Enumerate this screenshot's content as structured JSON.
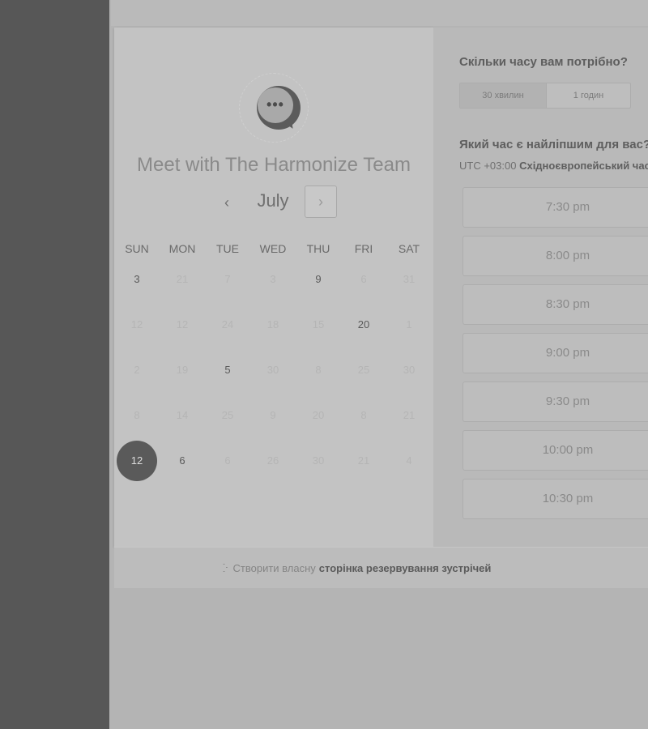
{
  "booking": {
    "title": "Meet with The Harmonize Team",
    "month": "July",
    "prev_glyph": "‹",
    "next_glyph": "›",
    "weekdays": [
      "SUN",
      "MON",
      "TUE",
      "WED",
      "THU",
      "FRI",
      "SAT"
    ],
    "weeks": [
      [
        {
          "d": "3",
          "a": true
        },
        {
          "d": "21",
          "a": false
        },
        {
          "d": "7",
          "a": false
        },
        {
          "d": "3",
          "a": false
        },
        {
          "d": "9",
          "a": true
        },
        {
          "d": "6",
          "a": false
        },
        {
          "d": "31",
          "a": false
        }
      ],
      [
        {
          "d": "12",
          "a": false
        },
        {
          "d": "12",
          "a": false
        },
        {
          "d": "24",
          "a": false
        },
        {
          "d": "18",
          "a": false
        },
        {
          "d": "15",
          "a": false
        },
        {
          "d": "20",
          "a": true
        },
        {
          "d": "1",
          "a": false
        }
      ],
      [
        {
          "d": "2",
          "a": false
        },
        {
          "d": "19",
          "a": false
        },
        {
          "d": "5",
          "a": true
        },
        {
          "d": "30",
          "a": false
        },
        {
          "d": "8",
          "a": false
        },
        {
          "d": "25",
          "a": false
        },
        {
          "d": "30",
          "a": false
        }
      ],
      [
        {
          "d": "8",
          "a": false
        },
        {
          "d": "14",
          "a": false
        },
        {
          "d": "25",
          "a": false
        },
        {
          "d": "9",
          "a": false
        },
        {
          "d": "20",
          "a": false
        },
        {
          "d": "8",
          "a": false
        },
        {
          "d": "21",
          "a": false
        }
      ],
      [
        {
          "d": "12",
          "a": true,
          "selected": true
        },
        {
          "d": "6",
          "a": true
        },
        {
          "d": "6",
          "a": false
        },
        {
          "d": "26",
          "a": false
        },
        {
          "d": "30",
          "a": false
        },
        {
          "d": "21",
          "a": false
        },
        {
          "d": "4",
          "a": false
        }
      ]
    ]
  },
  "scheduler": {
    "duration_question": "Скільки часу вам потрібно?",
    "durations": [
      {
        "label": "30 хвилин",
        "active": true
      },
      {
        "label": "1 годин",
        "active": false
      }
    ],
    "time_question": "Який час є найліпшим для вас?",
    "tz_prefix": "UTC +03:00",
    "tz_name": "Східноєвропейський час",
    "slots": [
      "7:30 pm",
      "8:00 pm",
      "8:30 pm",
      "9:00 pm",
      "9:30 pm",
      "10:00 pm",
      "10:30 pm"
    ]
  },
  "footer": {
    "icon": "sprocket-icon",
    "lead": "Створити власну",
    "brand": "сторінка резервування зустрічей"
  }
}
